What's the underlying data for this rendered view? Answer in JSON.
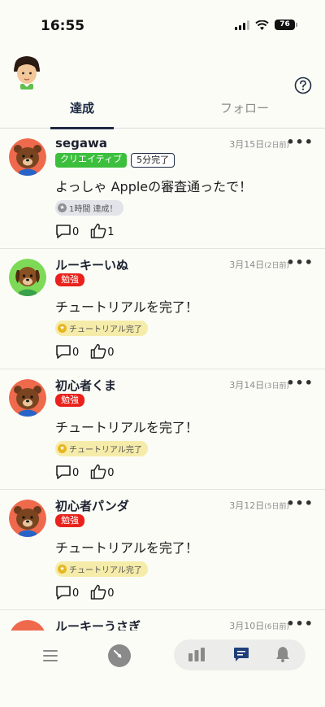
{
  "status": {
    "time": "16:55",
    "battery": "76"
  },
  "icons": {
    "me": "user-avatar",
    "help": "question-icon",
    "signal": "signal-icon",
    "wifi": "wifi-icon",
    "battery": "battery-icon"
  },
  "tabs": [
    {
      "label": "達成",
      "active": true
    },
    {
      "label": "フォロー",
      "active": false
    }
  ],
  "posts": [
    {
      "name": "segawa",
      "date": "3月15日",
      "date_ago": "(2日前)",
      "more": "•••",
      "tags": [
        "クリエイティブ",
        "5分完了"
      ],
      "message": "よっしゃ Appleの審査通ったで！",
      "badge": "1時間 達成！",
      "comments": "0",
      "likes": "1"
    },
    {
      "name": "ルーキーいぬ",
      "date": "3月14日",
      "date_ago": "(2日前)",
      "more": "•••",
      "tags": [
        "勉強"
      ],
      "message": "チュートリアルを完了！",
      "badge": "チュートリアル完了",
      "comments": "0",
      "likes": "0"
    },
    {
      "name": "初心者くま",
      "date": "3月14日",
      "date_ago": "(3日前)",
      "more": "•••",
      "tags": [
        "勉強"
      ],
      "message": "チュートリアルを完了！",
      "badge": "チュートリアル完了",
      "comments": "0",
      "likes": "0"
    },
    {
      "name": "初心者パンダ",
      "date": "3月12日",
      "date_ago": "(5日前)",
      "more": "•••",
      "tags": [
        "勉強"
      ],
      "message": "チュートリアルを完了！",
      "badge": "チュートリアル完了",
      "comments": "0",
      "likes": "0"
    },
    {
      "name": "ルーキーうさぎ",
      "date": "3月10日",
      "date_ago": "(6日前)",
      "more": "•••"
    }
  ],
  "bottom_nav": [
    "menu-icon",
    "gauge-icon",
    "stats-icon",
    "chat-icon",
    "bell-icon"
  ],
  "colors": {
    "accent": "#1f2a44",
    "tag_green": "#3cbf3c",
    "tag_red": "#e9221b",
    "badge_yellow": "#f6ecaa"
  }
}
